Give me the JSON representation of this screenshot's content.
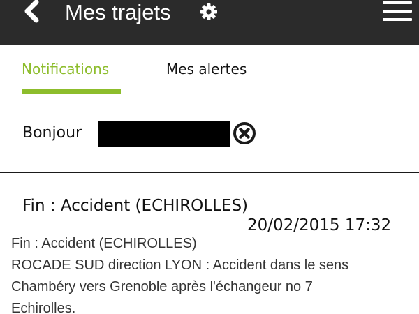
{
  "header": {
    "title": "Mes trajets",
    "back_icon": "chevron-left-icon",
    "settings_icon": "gear-icon",
    "menu_icon": "hamburger-menu-icon"
  },
  "tabs": [
    {
      "label": "Notifications",
      "active": true
    },
    {
      "label": "Mes alertes",
      "active": false
    }
  ],
  "colors": {
    "accent": "#8dbd2c",
    "header_bg": "#2b2b2b"
  },
  "greeting": {
    "label": "Bonjour",
    "close_icon": "close-circle-icon"
  },
  "notification": {
    "title": "Fin : Accident (ECHIROLLES)",
    "datetime": "20/02/2015 17:32",
    "body_lines": [
      "Fin : Accident (ECHIROLLES)",
      "ROCADE SUD direction LYON : Accident dans le sens",
      "Chambéry vers Grenoble après l'échangeur no 7",
      "Echirolles."
    ]
  }
}
